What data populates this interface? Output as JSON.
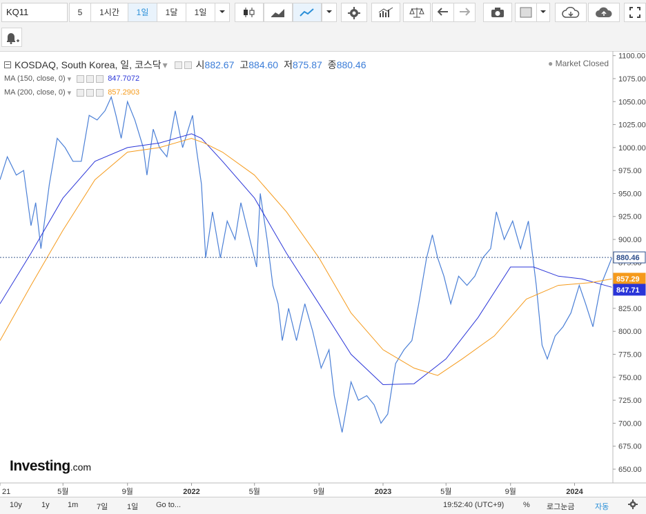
{
  "toolbar": {
    "symbol": "KQ11",
    "intervals": [
      "5",
      "1시간",
      "1일",
      "1달",
      "1일"
    ],
    "active_interval": "1일"
  },
  "legend": {
    "title": "KOSDAQ, South Korea, 일, 코스닥",
    "ohlc": [
      {
        "label": "시",
        "value": "882.67"
      },
      {
        "label": "고",
        "value": "884.60"
      },
      {
        "label": "저",
        "value": "875.87"
      },
      {
        "label": "종",
        "value": "880.46"
      }
    ],
    "ma150": {
      "label": "MA (150, close, 0)",
      "value": "847.7072",
      "color": "#2a35d8"
    },
    "ma200": {
      "label": "MA (200, close, 0)",
      "value": "857.2903",
      "color": "#f59a1b"
    },
    "status": "Market Closed"
  },
  "brand": {
    "name": "Investing",
    "suffix": ".com"
  },
  "bottom": {
    "ranges": [
      "10y",
      "1y",
      "1m",
      "7일",
      "1일"
    ],
    "goto": "Go to...",
    "time": "19:52:40 (UTC+9)",
    "percent": "%",
    "log": "로그눈금",
    "auto": "자동"
  },
  "chart_data": {
    "type": "line",
    "x_tick_labels": [
      "21",
      "5월",
      "9월",
      "2022",
      "5월",
      "9월",
      "2023",
      "5월",
      "9월",
      "2024"
    ],
    "y_ticks": [
      650,
      675,
      700,
      725,
      750,
      775,
      800,
      825,
      850,
      875,
      900,
      925,
      950,
      975,
      1000,
      1025,
      1050,
      1075,
      1100
    ],
    "ylim": [
      635,
      1105
    ],
    "last_value_label": "880.46",
    "colors": {
      "price": "#4a7fd6",
      "ma150": "#2a35d8",
      "ma200": "#f59a1b"
    },
    "series": [
      {
        "key": "price",
        "name": "KOSDAQ",
        "x": [
          "2021-01-01",
          "2021-01-15",
          "2021-02-01",
          "2021-02-15",
          "2021-03-01",
          "2021-03-10",
          "2021-03-20",
          "2021-04-05",
          "2021-04-20",
          "2021-05-05",
          "2021-05-20",
          "2021-06-05",
          "2021-06-20",
          "2021-07-05",
          "2021-07-20",
          "2021-08-01",
          "2021-08-10",
          "2021-08-20",
          "2021-09-01",
          "2021-09-15",
          "2021-10-01",
          "2021-10-08",
          "2021-10-20",
          "2021-11-01",
          "2021-11-15",
          "2021-12-01",
          "2021-12-15",
          "2022-01-03",
          "2022-01-10",
          "2022-01-20",
          "2022-01-28",
          "2022-02-10",
          "2022-02-25",
          "2022-03-10",
          "2022-03-25",
          "2022-04-05",
          "2022-04-20",
          "2022-05-05",
          "2022-05-12",
          "2022-05-25",
          "2022-06-05",
          "2022-06-15",
          "2022-06-23",
          "2022-07-05",
          "2022-07-20",
          "2022-08-05",
          "2022-08-20",
          "2022-09-05",
          "2022-09-20",
          "2022-09-30",
          "2022-10-15",
          "2022-11-01",
          "2022-11-15",
          "2022-12-01",
          "2022-12-15",
          "2022-12-28",
          "2023-01-10",
          "2023-01-25",
          "2023-02-10",
          "2023-02-25",
          "2023-03-10",
          "2023-03-25",
          "2023-04-05",
          "2023-04-15",
          "2023-04-27",
          "2023-05-10",
          "2023-05-25",
          "2023-06-10",
          "2023-06-25",
          "2023-07-10",
          "2023-07-25",
          "2023-08-05",
          "2023-08-20",
          "2023-09-05",
          "2023-09-20",
          "2023-10-05",
          "2023-10-20",
          "2023-10-31",
          "2023-11-10",
          "2023-11-25",
          "2023-12-10",
          "2023-12-25",
          "2024-01-10",
          "2024-01-22",
          "2024-02-05",
          "2024-02-20",
          "2024-03-05",
          "2024-03-12"
        ],
        "y": [
          965,
          990,
          970,
          975,
          915,
          940,
          890,
          960,
          1010,
          1000,
          985,
          985,
          1035,
          1030,
          1040,
          1055,
          1035,
          1010,
          1050,
          1030,
          1000,
          970,
          1020,
          1000,
          990,
          1040,
          1000,
          1035,
          1000,
          960,
          880,
          930,
          880,
          920,
          900,
          940,
          905,
          870,
          950,
          900,
          850,
          830,
          790,
          825,
          790,
          830,
          800,
          760,
          780,
          730,
          690,
          745,
          725,
          730,
          720,
          700,
          710,
          765,
          780,
          790,
          830,
          880,
          905,
          880,
          860,
          830,
          860,
          850,
          860,
          880,
          890,
          930,
          900,
          920,
          890,
          920,
          850,
          785,
          770,
          795,
          805,
          820,
          850,
          830,
          805,
          850,
          870,
          880
        ]
      },
      {
        "key": "ma150",
        "name": "MA (150, close, 0)",
        "x": [
          "2021-01-01",
          "2021-03-01",
          "2021-05-01",
          "2021-07-01",
          "2021-09-01",
          "2021-11-01",
          "2022-01-01",
          "2022-01-20",
          "2022-03-01",
          "2022-05-01",
          "2022-07-01",
          "2022-09-01",
          "2022-11-01",
          "2023-01-01",
          "2023-03-01",
          "2023-05-01",
          "2023-07-01",
          "2023-09-01",
          "2023-10-15",
          "2023-12-01",
          "2024-01-15",
          "2024-03-12"
        ],
        "y": [
          830,
          885,
          945,
          985,
          1000,
          1005,
          1015,
          1010,
          985,
          945,
          885,
          830,
          775,
          742,
          743,
          770,
          815,
          870,
          870,
          860,
          857,
          848
        ]
      },
      {
        "key": "ma200",
        "name": "MA (200, close, 0)",
        "x": [
          "2021-01-01",
          "2021-03-01",
          "2021-05-01",
          "2021-07-01",
          "2021-09-01",
          "2021-11-01",
          "2022-01-01",
          "2022-01-25",
          "2022-03-01",
          "2022-05-01",
          "2022-07-01",
          "2022-09-01",
          "2022-11-01",
          "2023-01-01",
          "2023-03-01",
          "2023-04-15",
          "2023-06-01",
          "2023-08-01",
          "2023-10-01",
          "2023-12-01",
          "2024-02-01",
          "2024-03-12"
        ],
        "y": [
          790,
          850,
          910,
          965,
          995,
          1000,
          1010,
          1005,
          995,
          970,
          930,
          880,
          820,
          780,
          760,
          752,
          770,
          795,
          835,
          850,
          853,
          857
        ]
      }
    ]
  }
}
